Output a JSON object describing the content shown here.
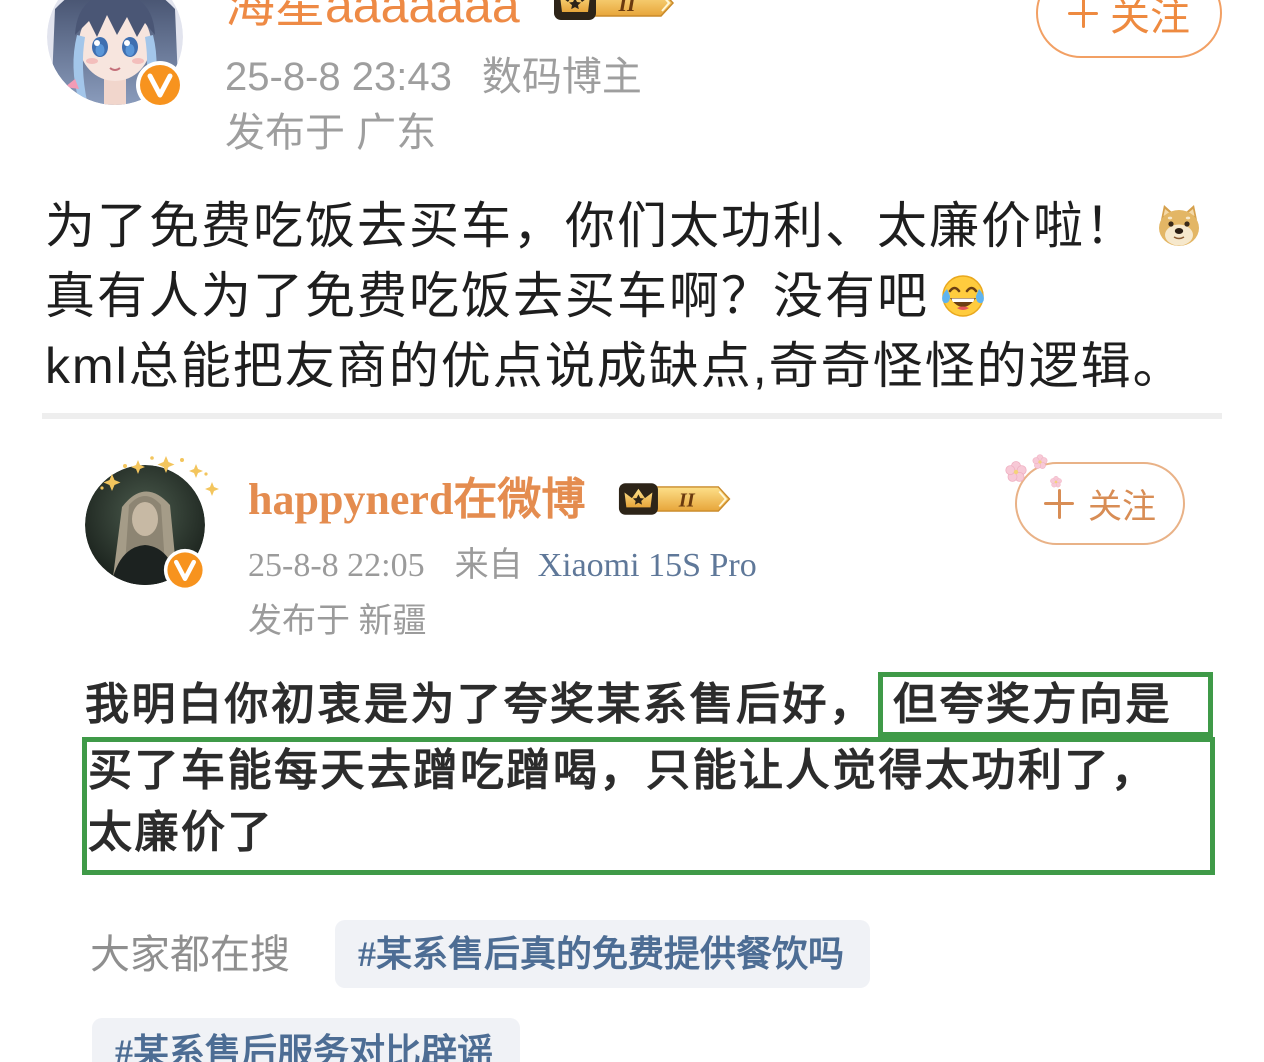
{
  "post": {
    "author_name": "海星aaaaaaa",
    "level_badge": "II",
    "follow_label": "关注",
    "meta_time": "25-8-8 23:43",
    "meta_role": "数码博主",
    "meta_location": "发布于 广东",
    "lines": [
      "为了免费吃饭去买车，你们太功利、太廉价啦！",
      "真有人为了免费吃饭去买车啊？没有吧",
      "kml总能把友商的优点说成缺点,奇奇怪怪的逻辑。"
    ]
  },
  "quoted": {
    "author_name": "happynerd在微博",
    "level_badge": "II",
    "follow_label": "关注",
    "meta_time": "25-8-8 22:05",
    "meta_source_prefix": "来自",
    "meta_source": "Xiaomi 15S Pro",
    "meta_location": "发布于 新疆",
    "body": {
      "line1_plain": "我明白你初衷是为了夸奖某系售后好，",
      "line1_highlighted": "但夸奖方向是",
      "line2": "买了车能每天去蹭吃蹭喝，只能让人觉得太功利了，",
      "line3": "太廉价了"
    },
    "trending_label": "大家都在搜",
    "hashtags": [
      "#某系售后真的免费提供餐饮吗",
      "#某系售后服务对比辟谣"
    ]
  },
  "icons": {
    "author_avatar": "avatar-anime-girl",
    "verified": "verified-badge-icon",
    "member_badge": "crown-icon",
    "follow": "plus-icon",
    "emoji_line1": "doge-emoji-icon",
    "emoji_line2": "laughing-crying-emoji-icon",
    "quoted_avatar": "avatar-photo"
  },
  "colors": {
    "username_orange": "#ee8a45",
    "follow_border": "#f2a064",
    "follow_text": "#ee8a40",
    "meta_gray": "#9e9e9e",
    "body_text": "#1e1e1e",
    "quoted_username": "#e48c4f",
    "quoted_follow_border": "#e9b287",
    "quoted_follow_text": "#d88d55",
    "quoted_meta_gray": "#9b9b9b",
    "source_blue": "#5f7899",
    "quoted_body": "#2c2c2c",
    "highlight_green": "#3f9a48",
    "trend_gray": "#8f8f8f",
    "hashtag_bg": "#f0f2f6",
    "hashtag_blue": "#4d6d94",
    "verified_orange": "#f7931e"
  }
}
